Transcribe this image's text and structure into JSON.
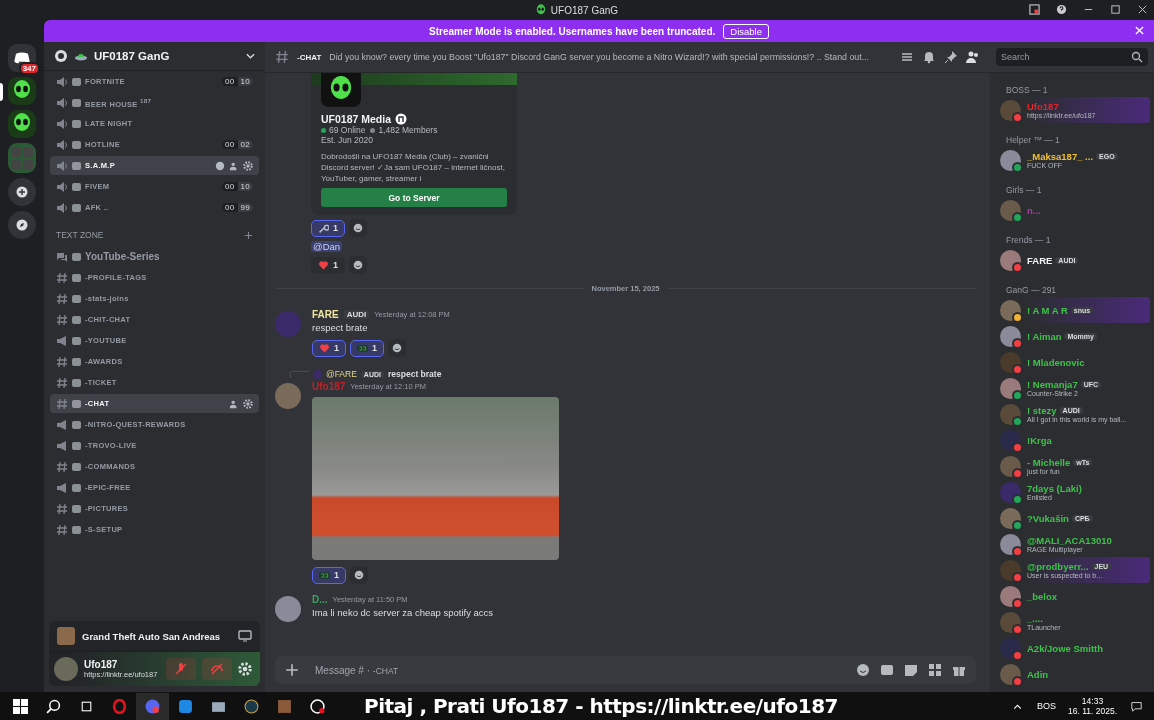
{
  "titlebar": {
    "title": "UFO187 GanG"
  },
  "banner": {
    "text": "Streamer Mode is enabled. Usernames have been truncated.",
    "button": "Disable"
  },
  "servers": [
    {
      "kind": "home",
      "badge": "347",
      "selected": false
    },
    {
      "kind": "alien",
      "selected": true
    },
    {
      "kind": "alien",
      "selected": false
    },
    {
      "kind": "folder",
      "selected": false
    },
    {
      "kind": "add",
      "selected": false
    },
    {
      "kind": "discover",
      "selected": false
    }
  ],
  "server": {
    "name": "UF0187 GanG"
  },
  "voice_channels": [
    {
      "name": "FORTNITE",
      "users": "00",
      "limit": "10",
      "selected": false
    },
    {
      "name": "BEER HOUSE $^{187}$",
      "selected": false
    },
    {
      "name": "LATE NIGHT",
      "selected": false
    },
    {
      "name": "HOTLINE",
      "users": "00",
      "limit": "02",
      "selected": false
    },
    {
      "name": "S.A.M.P",
      "selected": true
    },
    {
      "name": "FIVEM",
      "users": "00",
      "limit": "10",
      "selected": false
    },
    {
      "name": "AFK ..",
      "users": "00",
      "limit": "99",
      "selected": false
    }
  ],
  "category": {
    "name": "TEXT ZONE"
  },
  "text_channels": [
    {
      "kind": "forum",
      "name": "YouTube-Series",
      "selected": false
    },
    {
      "kind": "text",
      "name": "-PROFILE-TAGS",
      "selected": false
    },
    {
      "kind": "text",
      "name": "-stats-joins",
      "selected": false
    },
    {
      "kind": "text",
      "name": "-CHIT-CHAT",
      "selected": false
    },
    {
      "kind": "announce",
      "name": "-YOUTUBE",
      "selected": false
    },
    {
      "kind": "text",
      "name": "-AWARDS",
      "selected": false
    },
    {
      "kind": "text",
      "name": "-TICKET",
      "selected": false
    },
    {
      "kind": "text",
      "name": "-CHAT",
      "selected": true
    },
    {
      "kind": "announce",
      "name": "-NITRO-QUEST-REWARDS",
      "selected": false
    },
    {
      "kind": "announce",
      "name": "-TROVO-LIVE",
      "selected": false
    },
    {
      "kind": "text",
      "name": "-COMMANDS",
      "selected": false
    },
    {
      "kind": "announce",
      "name": "-EPIC-FREE",
      "selected": false
    },
    {
      "kind": "text",
      "name": "-PICTURES",
      "selected": false
    },
    {
      "kind": "text",
      "name": "-S-SETUP",
      "selected": false
    }
  ],
  "activity": {
    "game": "Grand Theft Auto San Andreas"
  },
  "user": {
    "name": "Ufo187",
    "status": "https://linktr.ee/ufo187",
    "muted": true,
    "deafened": true
  },
  "chat": {
    "channel": "-CHAT",
    "topic": "Did you know? every time you Boost \"Ufo187\" Discord GanG server you become a  Nitro Wizard!? with special permissions!? .. Stand out...",
    "search_placeholder": "Search",
    "composer_placeholder": "Message # · ",
    "composer_channel": "-CHAT"
  },
  "invite": {
    "name": "UF0187 Media",
    "online": "69 Online",
    "members": "1,482 Members",
    "est": "Est. Jun 2020",
    "description": "Dobrodošli na UFO187 Media (Club) – zvanični Discord server! ✓Ja sam UFO187 – internet ličnost, YouTuber, gamer, streamer i",
    "button": "Go to Server"
  },
  "invite_reactions": [
    {
      "kind": "wrench",
      "count": "1",
      "selected": true
    }
  ],
  "mention": "@Dan",
  "mention_reactions": [
    {
      "kind": "heart",
      "count": "1",
      "selected": false
    }
  ],
  "date_divider": "November 15, 2025",
  "messages": [
    {
      "kind": "text",
      "author": "FARE",
      "color": "#f0e6a0",
      "tag": "AUDI",
      "time": "Yesterday at 12:08 PM",
      "text": "respect brate",
      "reactions": [
        {
          "kind": "heart",
          "count": "1",
          "selected": true
        },
        {
          "kind": "gg",
          "count": "1",
          "selected": true
        }
      ]
    },
    {
      "kind": "image",
      "reply_author": "@FARE",
      "reply_tag": "AUDI",
      "reply_text": "respect brate",
      "author": "Ufo187",
      "color": "#c0222a",
      "time": "Yesterday at 12:10 PM",
      "reactions": [
        {
          "kind": "gg",
          "count": "1",
          "selected": true
        }
      ]
    },
    {
      "kind": "text",
      "author": "D...",
      "color": "#3ba55c",
      "time": "Yesterday at 11:50 PM",
      "text": "Ima li neko dc server za cheap spotify accs"
    }
  ],
  "member_groups": [
    {
      "name": "BOSS — 1",
      "color": "#e0252b",
      "members": [
        {
          "name": "Ufo187",
          "color": "#f23f43",
          "highlight": true,
          "activity": "https://linktr.ee/ufo187"
        }
      ]
    },
    {
      "name": "Helper ™ — 1",
      "color": "#f0c030",
      "members": [
        {
          "name": "_Maksa187_ ...",
          "color": "#23a55a",
          "highlight": false,
          "tag": "EGO",
          "activity": "FUCK OFF"
        }
      ]
    },
    {
      "name": "Girls — 1",
      "color": "#b03aa8",
      "members": [
        {
          "name": "n...",
          "color": "#23a55a",
          "highlight": false
        }
      ]
    },
    {
      "name": "Frends — 1",
      "color": "#f2f3f5",
      "members": [
        {
          "name": "FARE",
          "color": "#f23f43",
          "highlight": false,
          "tag": "AUDI"
        }
      ]
    },
    {
      "name": "GanG — 291",
      "color": "#3ec24a",
      "members": [
        {
          "name": "! A M A R",
          "color": "#f0b232",
          "highlight": true,
          "tag": "snus"
        },
        {
          "name": "! Aiman",
          "color": "#f23f43",
          "highlight": false,
          "tag": "Mommy"
        },
        {
          "name": "! Mladenovic",
          "color": "#f23f43",
          "highlight": false
        },
        {
          "name": "! Nemanja7",
          "color": "#23a55a",
          "highlight": false,
          "tag": "UFC",
          "activity": "Counter-Strike 2"
        },
        {
          "name": "! stezy",
          "color": "#23a55a",
          "highlight": false,
          "tag": "AUDI",
          "activity": "All I got in this world is my ball..."
        },
        {
          "name": "!Krga",
          "color": "#f23f43",
          "highlight": false
        },
        {
          "name": "- Michelle",
          "color": "#f23f43",
          "highlight": false,
          "tag": "wTs",
          "activity": "just for fun"
        },
        {
          "name": "7days (Laki)",
          "color": "#23a55a",
          "highlight": false,
          "activity": "Enlisted"
        },
        {
          "name": "?Vukašin",
          "color": "#23a55a",
          "highlight": false,
          "tag": "СРБ"
        },
        {
          "name": "@MALI_ACA13010",
          "color": "#f23f43",
          "highlight": false,
          "activity": "RAGE Multiplayer"
        },
        {
          "name": "@prodbyerr...",
          "color": "#f23f43",
          "highlight": true,
          "tag": "JEU",
          "activity": "User is suspected to b..."
        },
        {
          "name": "_belox",
          "color": "#f23f43",
          "highlight": false
        },
        {
          "name": "_....",
          "color": "#f23f43",
          "highlight": false,
          "activity": "TLauncher"
        },
        {
          "name": "A2k/Jowe Smitth",
          "color": "#f23f43",
          "highlight": false
        },
        {
          "name": "Adin",
          "color": "#f23f43",
          "highlight": false
        }
      ]
    }
  ],
  "taskbar": {
    "overlay": "Pitaj , Prati Ufo187 - https://linktr.ee/ufo187",
    "language": "BOS",
    "time": "14:33",
    "date": "16. 11. 2025."
  }
}
